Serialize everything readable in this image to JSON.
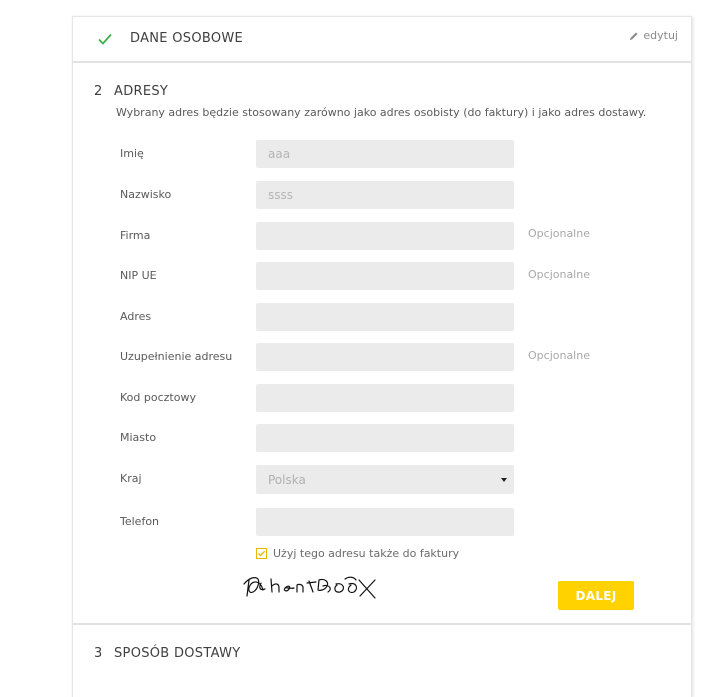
{
  "step1": {
    "title": "DANE OSOBOWE",
    "edit_label": "edytuj",
    "check_icon": "check-icon",
    "edit_icon": "pencil-icon",
    "check_color": "#3fae49"
  },
  "step2": {
    "number": "2",
    "title": "ADRESY",
    "description": "Wybrany adres będzie stosowany zarówno jako adres osobisty (do faktury) i jako adres dostawy.",
    "fields": [
      {
        "label": "Imię",
        "placeholder": "aaa",
        "optional": ""
      },
      {
        "label": "Nazwisko",
        "placeholder": "ssss",
        "optional": ""
      },
      {
        "label": "Firma",
        "placeholder": "",
        "optional": "Opcjonalne"
      },
      {
        "label": "NIP UE",
        "placeholder": "",
        "optional": "Opcjonalne"
      },
      {
        "label": "Adres",
        "placeholder": "",
        "optional": ""
      },
      {
        "label": "Uzupełnienie adresu",
        "placeholder": "",
        "optional": "Opcjonalne"
      },
      {
        "label": "Kod pocztowy",
        "placeholder": "",
        "optional": ""
      },
      {
        "label": "Miasto",
        "placeholder": "",
        "optional": ""
      }
    ],
    "country": {
      "label": "Kraj",
      "value": "Polska"
    },
    "phone": {
      "label": "Telefon",
      "placeholder": ""
    },
    "checkbox_label": "Użyj tego adresu także do faktury",
    "checkbox_checked": true,
    "next_button": "DALEJ",
    "accent_color": "#ffd200"
  },
  "step3": {
    "number": "3",
    "title": "SPOSÓB DOSTAWY"
  }
}
